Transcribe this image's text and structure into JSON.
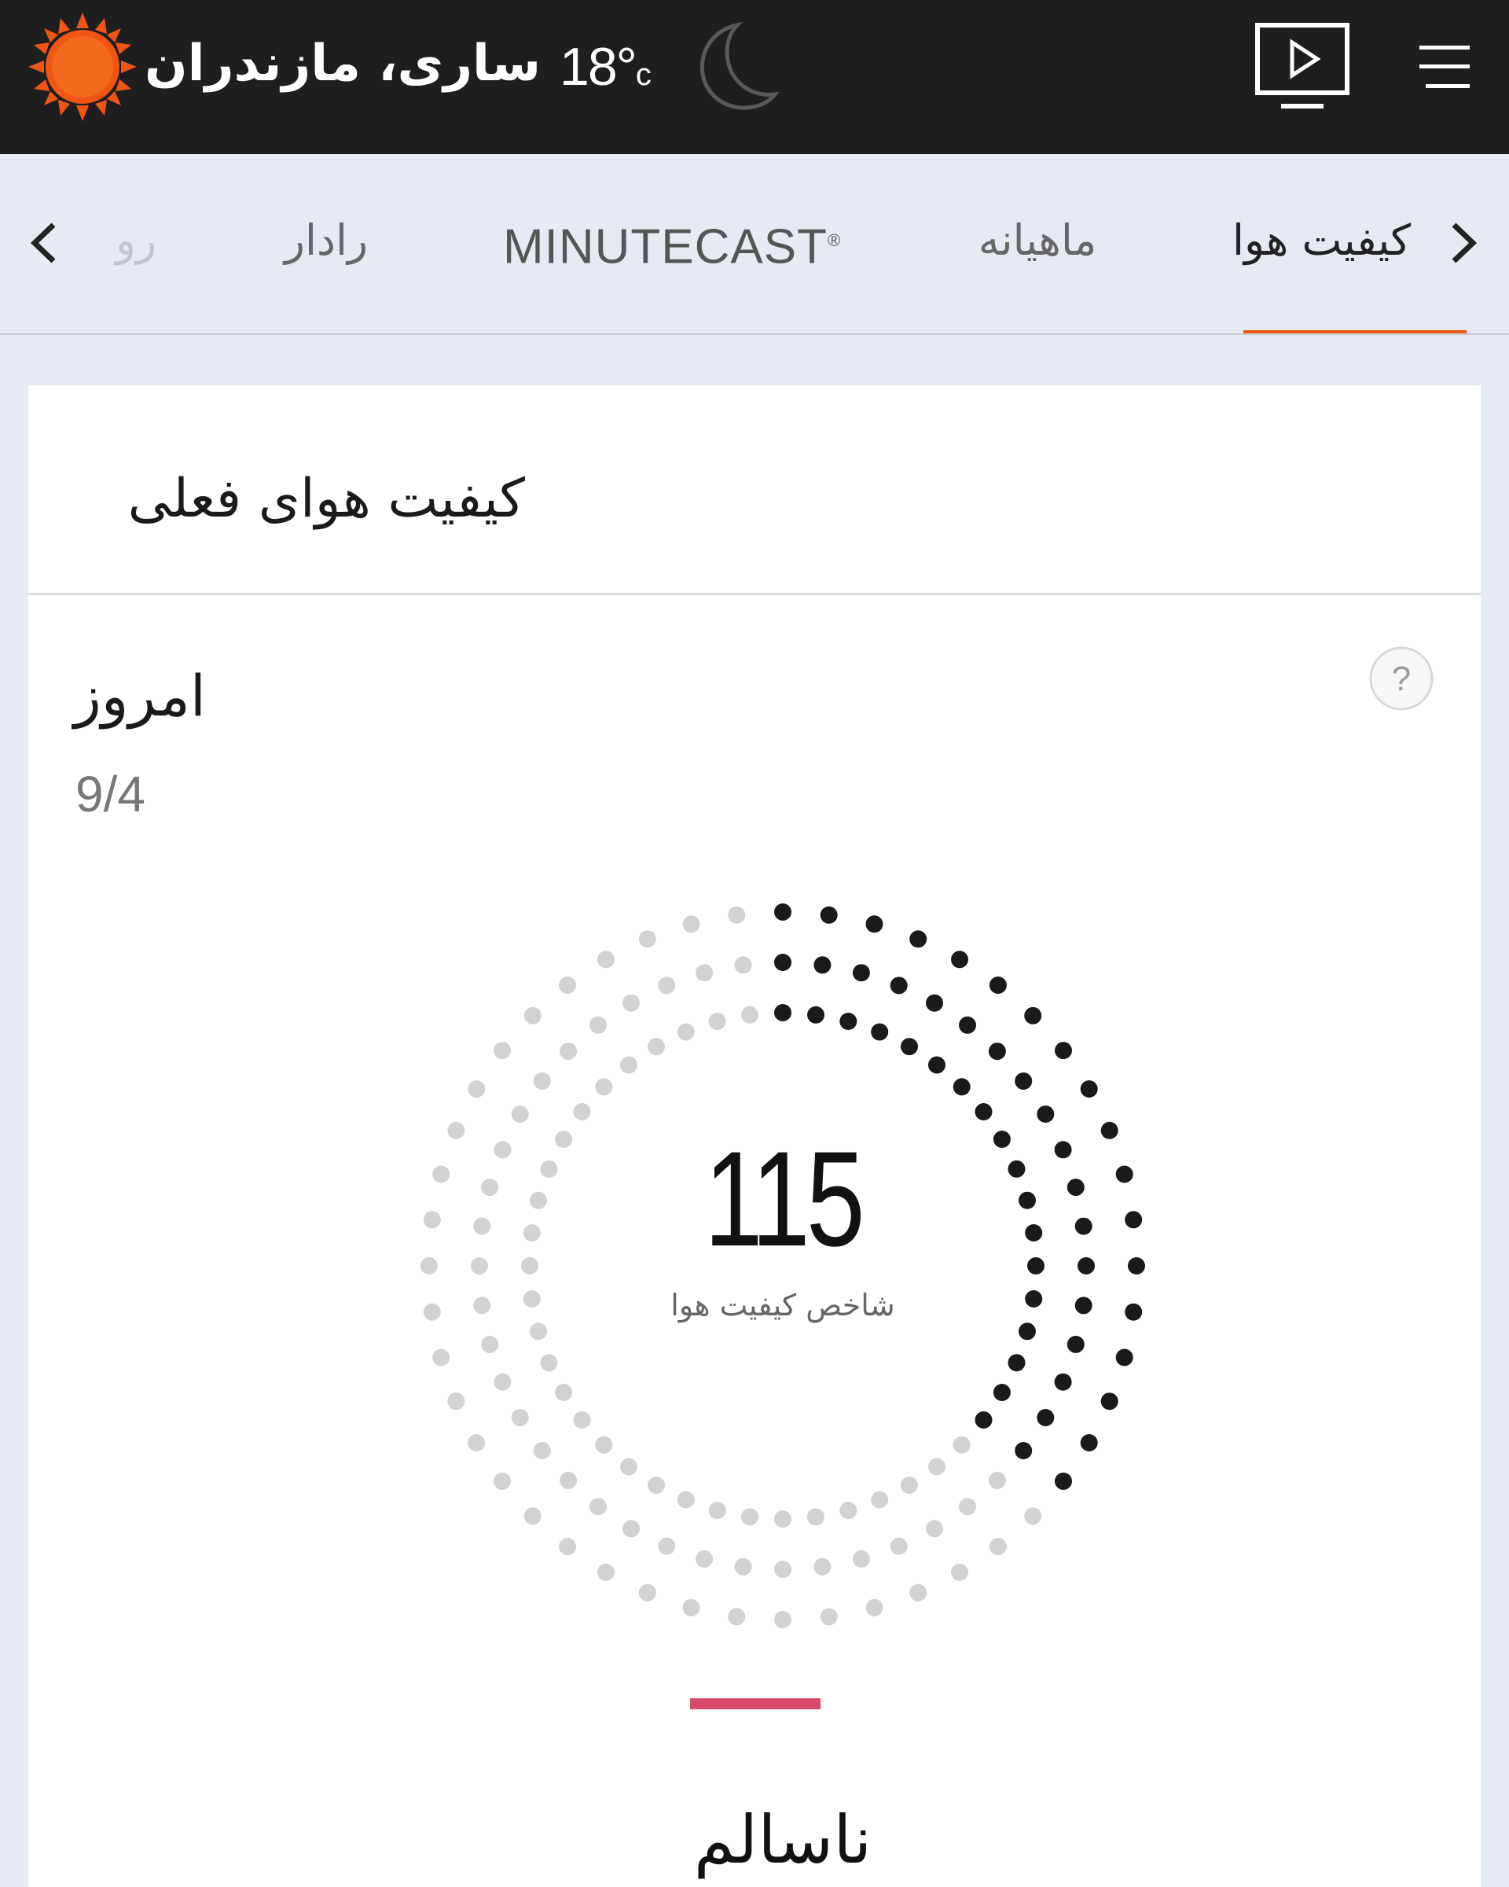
{
  "header": {
    "location": "ساری، مازندران",
    "temperature": "18°",
    "temperature_unit": "c",
    "logo_icon": "sun-logo-icon",
    "moon_icon": "crescent-moon-icon",
    "video_icon": "video-play-icon",
    "menu_icon": "hamburger-menu-icon"
  },
  "tabs": [
    {
      "label": "کیفیت هوا",
      "active": true
    },
    {
      "label": "ماهیانه",
      "active": false
    },
    {
      "label": "MINUTECAST",
      "active": false
    },
    {
      "label": "رادار",
      "active": false
    },
    {
      "label": "رو",
      "active": false
    }
  ],
  "tab_mark": "®",
  "card": {
    "title": "کیفیت هوای فعلی",
    "help_symbol": "?",
    "day_label": "امروز",
    "date": "9/4",
    "aqi_value": "115",
    "aqi_caption": "شاخص کیفیت هوا",
    "status_label": "ناسالم",
    "status_color": "#d94a6a",
    "dial_fill_fraction": 0.375
  },
  "colors": {
    "accent": "#f05514",
    "header_bg": "#1e1e1e",
    "page_bg": "#e6eaf2",
    "dot_active": "#1a1a1a",
    "dot_inactive": "#d2d2d2"
  }
}
